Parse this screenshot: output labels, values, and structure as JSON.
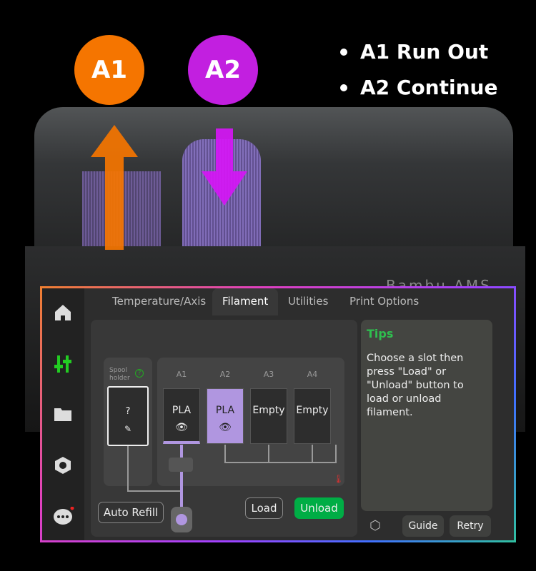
{
  "overlay": {
    "badge_a1": "A1",
    "badge_a2": "A2",
    "bullets": [
      "A1 Run Out",
      "A2 Continue"
    ],
    "colors": {
      "a1": "#f57500",
      "a2": "#c21fe0",
      "filament": "#b096e0",
      "unload": "#00ad45"
    },
    "device_brand": "Bambu AMS"
  },
  "sidebar": {
    "items": [
      {
        "icon": "home-icon"
      },
      {
        "icon": "sliders-icon",
        "active": true
      },
      {
        "icon": "folder-icon"
      },
      {
        "icon": "hex-nut-icon"
      },
      {
        "icon": "chat-icon",
        "notification": true
      }
    ]
  },
  "tabs": [
    {
      "label": "Temperature/Axis"
    },
    {
      "label": "Filament",
      "active": true
    },
    {
      "label": "Utilities"
    },
    {
      "label": "Print Options"
    }
  ],
  "filament": {
    "spool_holder": {
      "label": "Spool holder",
      "value": "?"
    },
    "slots": [
      {
        "id": "A1",
        "material": "PLA",
        "active": true
      },
      {
        "id": "A2",
        "material": "PLA",
        "selected": true
      },
      {
        "id": "A3",
        "material": "Empty"
      },
      {
        "id": "A4",
        "material": "Empty"
      }
    ],
    "auto_refill": "Auto Refill",
    "load": "Load",
    "unload": "Unload"
  },
  "tips": {
    "title": "Tips",
    "text": "Choose a slot then press \"Load\" or \"Unload\" button to load or unload filament."
  },
  "footer": {
    "guide": "Guide",
    "retry": "Retry"
  }
}
